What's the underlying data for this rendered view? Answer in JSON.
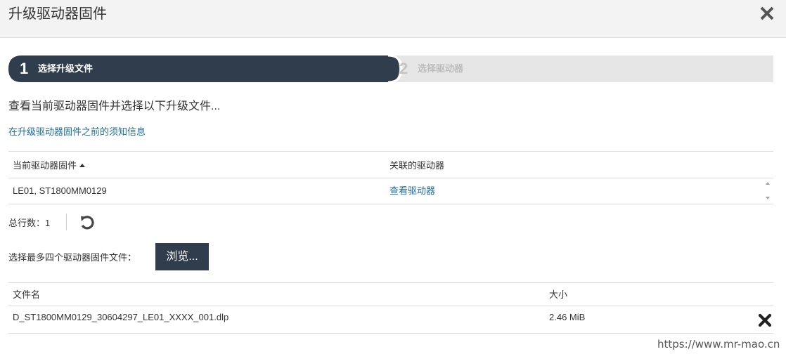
{
  "dialog": {
    "title": "升级驱动器固件",
    "close_icon": "close-x-icon"
  },
  "wizard": {
    "steps": [
      {
        "number": "1",
        "label": "选择升级文件",
        "state": "active"
      },
      {
        "number": "2",
        "label": "选择驱动器",
        "state": "inactive"
      }
    ],
    "active_color": "#2f3d4c",
    "inactive_color": "#e6e6e6"
  },
  "instruction": "查看当前驱动器固件并选择以下升级文件...",
  "info_link": "在升级驱动器固件之前的须知信息",
  "firmware_table": {
    "columns": [
      "当前驱动器固件",
      "关联的驱动器"
    ],
    "sort_column": "当前驱动器固件",
    "sort_direction": "ascending",
    "rows": [
      {
        "firmware": "LE01, ST1800MM0129",
        "drives_link": "查看驱动器"
      }
    ]
  },
  "total_rows": "总行数：1",
  "file_select": {
    "label": "选择最多四个驱动器固件文件：",
    "browse_label": "浏览..."
  },
  "files_table": {
    "columns": [
      "文件名",
      "大小"
    ],
    "rows": [
      {
        "name": "D_ST1800MM0129_30604297_LE01_XXXX_001.dlp",
        "size": "2.46 MiB"
      }
    ]
  },
  "watermark": "https://www.mr-mao.cn",
  "colors": {
    "link": "#1a6c9c",
    "button_dark": "#2f3d4c",
    "header_bg": "#f3f3f3"
  }
}
